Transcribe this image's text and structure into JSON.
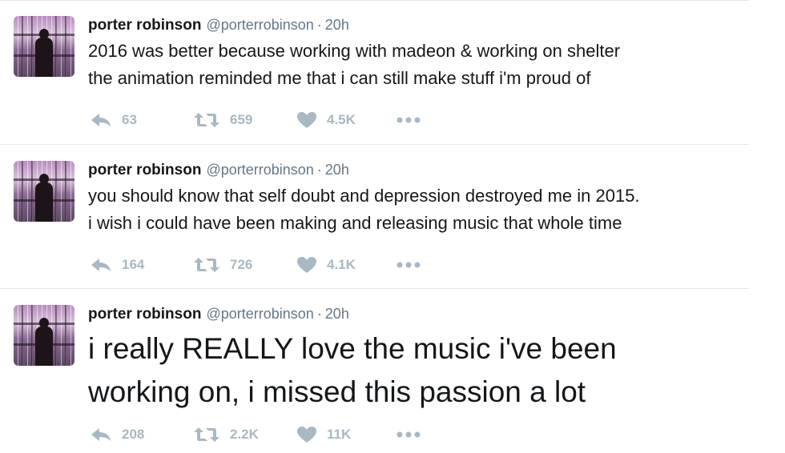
{
  "colors": {
    "icon_gray": "#aab8c2",
    "meta_gray": "#657786",
    "text": "#14171a",
    "divider": "#e1e8ed"
  },
  "tweets": [
    {
      "author": {
        "name": "porter robinson",
        "handle": "@porterrobinson"
      },
      "separator": "·",
      "time": "20h",
      "lines": [
        "2016 was better because working with madeon & working on shelter",
        "the animation reminded me that i can still make stuff i'm proud of"
      ],
      "counts": {
        "replies": "63",
        "retweets": "659",
        "likes": "4.5K"
      }
    },
    {
      "author": {
        "name": "porter robinson",
        "handle": "@porterrobinson"
      },
      "separator": "·",
      "time": "20h",
      "lines": [
        "you should know that self doubt and depression destroyed me in 2015.",
        "i wish i could have been making and releasing music that whole time"
      ],
      "counts": {
        "replies": "164",
        "retweets": "726",
        "likes": "4.1K"
      }
    },
    {
      "author": {
        "name": "porter robinson",
        "handle": "@porterrobinson"
      },
      "separator": "·",
      "time": "20h",
      "lines": [
        "i really REALLY love the music i've been",
        "working on, i missed this passion a lot"
      ],
      "counts": {
        "replies": "208",
        "retweets": "2.2K",
        "likes": "11K"
      }
    }
  ],
  "icons": {
    "reply": "reply-icon",
    "retweet": "retweet-icon",
    "like": "heart-icon",
    "more": "more-dots-icon"
  }
}
